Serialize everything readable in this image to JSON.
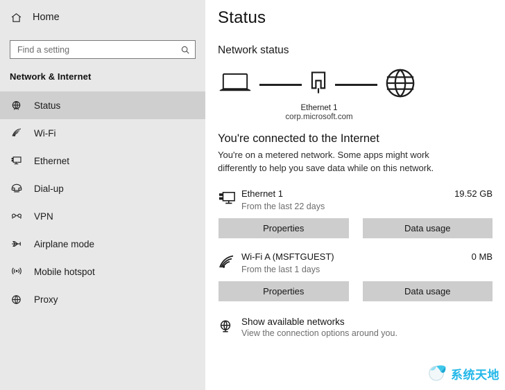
{
  "sidebar": {
    "home": {
      "label": "Home",
      "icon": "home-icon"
    },
    "search": {
      "value": "",
      "placeholder": "Find a setting",
      "icon": "search-icon"
    },
    "section_title": "Network & Internet",
    "items": [
      {
        "label": "Status",
        "icon": "globe-status-icon",
        "selected": true
      },
      {
        "label": "Wi-Fi",
        "icon": "wifi-icon",
        "selected": false
      },
      {
        "label": "Ethernet",
        "icon": "ethernet-icon",
        "selected": false
      },
      {
        "label": "Dial-up",
        "icon": "dialup-phone-icon",
        "selected": false
      },
      {
        "label": "VPN",
        "icon": "vpn-key-icon",
        "selected": false
      },
      {
        "label": "Airplane mode",
        "icon": "airplane-icon",
        "selected": false
      },
      {
        "label": "Mobile hotspot",
        "icon": "hotspot-icon",
        "selected": false
      },
      {
        "label": "Proxy",
        "icon": "proxy-globe-icon",
        "selected": false
      }
    ]
  },
  "main": {
    "page_title": "Status",
    "section_heading": "Network status",
    "diagram": {
      "device_icon": "laptop-icon",
      "adapter_icon": "ethernet-port-icon",
      "internet_icon": "globe-icon",
      "adapter_label": "Ethernet 1",
      "domain_label": "corp.microsoft.com"
    },
    "connection": {
      "headline": "You're connected to the Internet",
      "description": "You're on a metered network. Some apps might work differently to help you save data while on this network."
    },
    "adapters": [
      {
        "icon": "pc-monitor-icon",
        "name": "Ethernet 1",
        "subtitle": "From the last 22 days",
        "amount": "19.52 GB",
        "buttons": [
          "Properties",
          "Data usage"
        ]
      },
      {
        "icon": "wifi-signal-icon",
        "name": "Wi-Fi A (MSFTGUEST)",
        "subtitle": "From the last 1 days",
        "amount": "0 MB",
        "buttons": [
          "Properties",
          "Data usage"
        ]
      }
    ],
    "show_networks": {
      "icon": "network-globe-icon",
      "title": "Show available networks",
      "subtitle": "View the connection options around you."
    }
  },
  "watermark": {
    "text": "系统天地",
    "icon": "sphere-logo-icon",
    "color": "#22b7e8"
  }
}
